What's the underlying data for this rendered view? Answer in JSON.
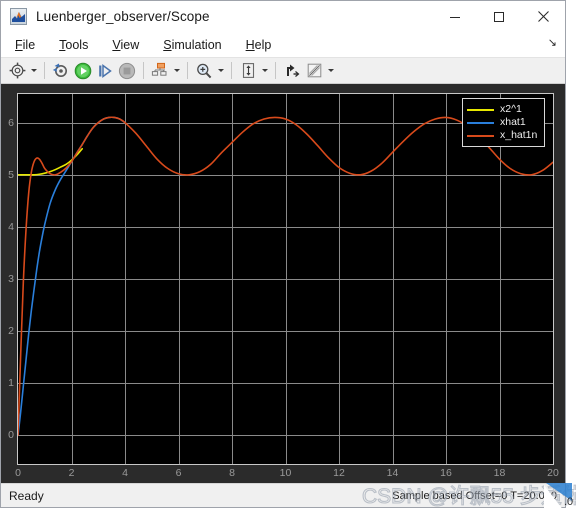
{
  "window": {
    "title": "Luenberger_observer/Scope",
    "icon": "matlab-scope-icon",
    "controls": {
      "minimize": "minimize-button",
      "maximize": "maximize-button",
      "close": "close-button"
    }
  },
  "menubar": {
    "items": [
      {
        "label": "File",
        "mnemonic": "F"
      },
      {
        "label": "Tools",
        "mnemonic": "T"
      },
      {
        "label": "View",
        "mnemonic": "V"
      },
      {
        "label": "Simulation",
        "mnemonic": "S"
      },
      {
        "label": "Help",
        "mnemonic": "H"
      }
    ],
    "overflow_glyph": "↘"
  },
  "toolbar": {
    "buttons": [
      {
        "name": "configuration-properties-icon",
        "has_caret": true
      },
      {
        "name": "update-diagram-icon",
        "has_caret": false
      },
      {
        "name": "run-icon",
        "has_caret": false
      },
      {
        "name": "step-forward-icon",
        "has_caret": false
      },
      {
        "name": "stop-icon",
        "has_caret": false
      },
      {
        "name": "signal-selection-icon",
        "has_caret": true
      },
      {
        "name": "zoom-in-icon",
        "has_caret": true
      },
      {
        "name": "autoscale-icon",
        "has_caret": true
      },
      {
        "name": "cursor-measurements-icon",
        "has_caret": false
      },
      {
        "name": "annotations-icon",
        "has_caret": true
      }
    ]
  },
  "scope": {
    "legend": {
      "position": "top-right",
      "entries": [
        {
          "label": "x2^1",
          "color": "#e8e800"
        },
        {
          "label": "xhat1",
          "color": "#2a7fdb"
        },
        {
          "label": "x_hat1n",
          "color": "#d84a1b"
        }
      ]
    }
  },
  "statusbar": {
    "ready_text": "Ready",
    "info_text": "Sample based Offset=0 T=20.000"
  },
  "watermark": {
    "text": "CSDN @许飘55 步适体",
    "corner_text": ".0"
  },
  "chart_data": {
    "type": "line",
    "title": "",
    "xlabel": "",
    "ylabel": "",
    "xlim": [
      0,
      20
    ],
    "ylim": [
      -0.55,
      6.55
    ],
    "xticks": [
      0,
      2,
      4,
      6,
      8,
      10,
      12,
      14,
      16,
      18,
      20
    ],
    "yticks": [
      0,
      1,
      2,
      3,
      4,
      5,
      6
    ],
    "grid": true,
    "background": "#000000",
    "grid_color": "#8a8a8a",
    "series": [
      {
        "name": "x2^1",
        "color": "#e8e800",
        "x": [
          0.0,
          0.15,
          0.3,
          0.45,
          0.6,
          0.8,
          1.0,
          1.2,
          1.4,
          1.6,
          1.8,
          2.0,
          2.2,
          2.4
        ],
        "y": [
          5.0,
          5.0,
          5.0,
          5.0,
          5.0,
          5.01,
          5.03,
          5.06,
          5.1,
          5.15,
          5.2,
          5.28,
          5.38,
          5.5
        ]
      },
      {
        "name": "xhat1",
        "color": "#2a7fdb",
        "x": [
          0.0,
          0.1,
          0.2,
          0.3,
          0.4,
          0.5,
          0.6,
          0.7,
          0.8,
          0.9,
          1.0,
          1.2,
          1.4,
          1.6,
          1.8,
          2.0,
          2.2,
          2.4,
          2.6,
          2.8,
          3.0,
          3.2,
          3.4,
          3.6,
          3.8,
          4.0
        ],
        "y": [
          0.0,
          0.45,
          0.95,
          1.45,
          1.95,
          2.4,
          2.8,
          3.18,
          3.52,
          3.8,
          4.05,
          4.45,
          4.72,
          4.92,
          5.08,
          5.25,
          5.42,
          5.58,
          5.75,
          5.9,
          6.0,
          6.07,
          6.1,
          6.1,
          6.07,
          6.0
        ]
      },
      {
        "name": "x_hat1n",
        "color": "#d84a1b",
        "x": [
          0.0,
          0.1,
          0.2,
          0.3,
          0.4,
          0.5,
          0.6,
          0.7,
          0.8,
          0.9,
          1.0,
          1.2,
          1.4,
          1.6,
          1.8,
          2.0,
          2.2,
          2.4,
          2.6,
          2.8,
          3.0,
          3.2,
          3.4,
          3.6,
          3.8,
          4.0,
          4.4,
          4.8,
          5.2,
          5.6,
          6.0,
          6.4,
          6.8,
          7.2,
          7.6,
          8.0,
          8.4,
          8.8,
          9.2,
          9.6,
          10.0,
          10.4,
          10.8,
          11.2,
          11.6,
          12.0,
          12.4,
          12.8,
          13.2,
          13.6,
          14.0,
          14.4,
          14.8,
          15.2,
          15.6,
          16.0,
          16.4,
          16.8,
          17.2,
          17.6,
          18.0,
          18.4,
          18.8,
          19.2,
          19.6,
          20.0
        ],
        "y": [
          0.0,
          1.55,
          2.95,
          3.95,
          4.65,
          5.05,
          5.25,
          5.32,
          5.3,
          5.22,
          5.12,
          5.02,
          5.0,
          5.05,
          5.13,
          5.25,
          5.42,
          5.58,
          5.75,
          5.9,
          6.0,
          6.07,
          6.1,
          6.1,
          6.07,
          6.0,
          5.8,
          5.55,
          5.3,
          5.12,
          5.02,
          5.0,
          5.06,
          5.2,
          5.42,
          5.62,
          5.82,
          5.98,
          6.07,
          6.1,
          6.07,
          5.96,
          5.78,
          5.56,
          5.33,
          5.14,
          5.03,
          5.0,
          5.07,
          5.22,
          5.43,
          5.64,
          5.83,
          5.98,
          6.07,
          6.1,
          6.05,
          5.93,
          5.75,
          5.53,
          5.3,
          5.12,
          5.02,
          5.0,
          5.08,
          5.24
        ]
      }
    ]
  }
}
